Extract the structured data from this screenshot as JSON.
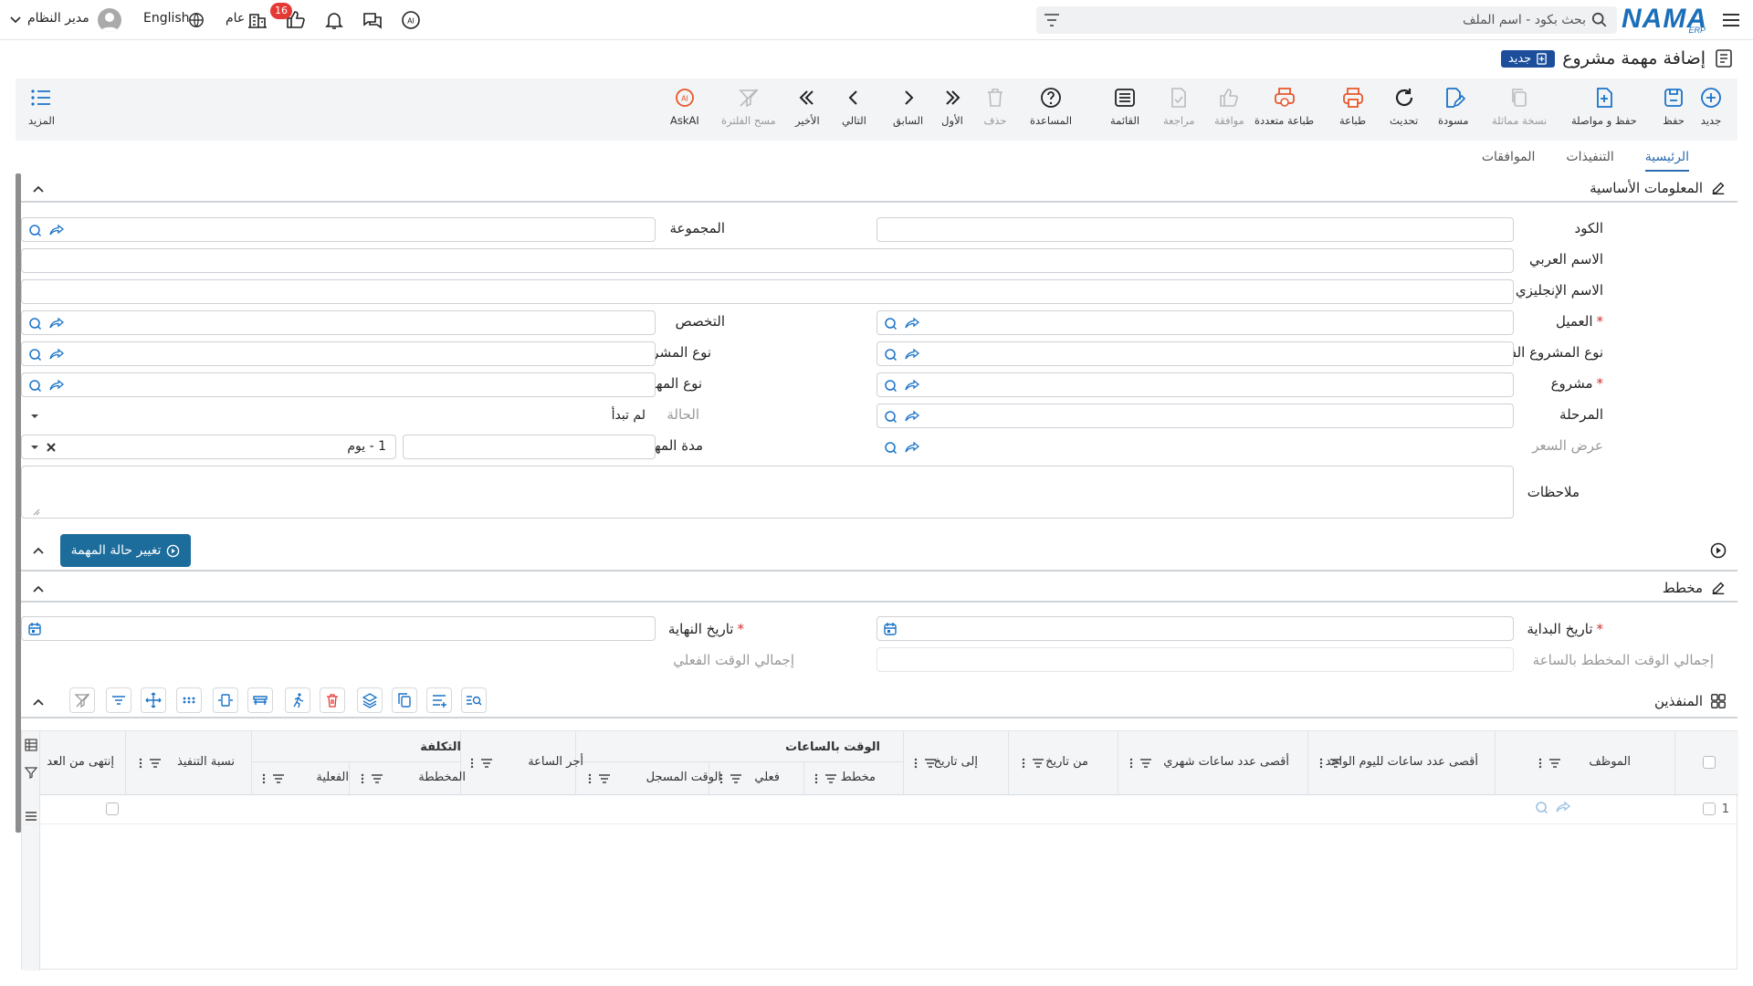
{
  "topbar": {
    "search_placeholder": "بحث بكود - اسم الملف",
    "badge_count": "16",
    "general_label": "عام",
    "language_label": "English",
    "user_name": "مدير النظام",
    "logo_text": "NAMA",
    "logo_sub": "ERP"
  },
  "page": {
    "title": "إضافة مهمة مشروع",
    "new_badge": "جديد"
  },
  "toolbar": {
    "new": "جديد",
    "save": "حفظ",
    "save_continue": "حفظ و مواصلة",
    "duplicate": "نسخة مماثلة",
    "draft": "مسودة",
    "refresh": "تحديث",
    "print": "طباعة",
    "multi_print": "طباعة متعددة",
    "approve": "موافقة",
    "review": "مراجعة",
    "list": "القائمة",
    "help": "المساعدة",
    "delete": "حذف",
    "first": "الأول",
    "previous": "السابق",
    "next": "التالي",
    "last": "الأخير",
    "clear_filter": "مسح الفلترة",
    "askai": "AskAI",
    "more": "المزيد"
  },
  "tabs": [
    "الرئيسية",
    "التنفيذات",
    "الموافقات"
  ],
  "basic_info": {
    "title": "المعلومات الأساسية",
    "code": "الكود",
    "group": "المجموعة",
    "arabic_name": "الاسم العربي",
    "english_name": "الاسم الإنجليزي",
    "customer": "العميل",
    "specialization": "التخصص",
    "sub_project_type": "نوع المشروع الفرعى",
    "project_type": "نوع المشروع",
    "project": "مشروع",
    "task_type": "نوع المهمة",
    "stage": "المرحلة",
    "status": "الحالة",
    "status_value": "لم تبدأ",
    "price_offer": "عرض السعر",
    "task_duration": "مدة المهمة",
    "duration_value": "1 - يوم",
    "notes": "ملاحظات"
  },
  "action": {
    "change_status": "تغيير حالة المهمة"
  },
  "plan": {
    "title": "مخطط",
    "start_date": "تاريخ البداية",
    "end_date": "تاريخ النهاية",
    "planned_total": "إجمالي الوقت المخطط بالساعة",
    "actual_total": "إجمالي الوقت الفعلي"
  },
  "executors": {
    "title": "المنفذين",
    "columns": {
      "employee": "الموظف",
      "max_daily": "أقصى عدد ساعات لليوم الواحد",
      "max_monthly": "أقصى عدد ساعات شهري",
      "from_date": "من تاريخ",
      "to_date": "إلى تاريخ",
      "time_hours": "الوقت بالساعات",
      "planned": "مخطط",
      "actual": "فعلي",
      "logged": "الوقت المسجل",
      "hour_rate": "أجر الساعة",
      "cost": "التكلفة",
      "cost_planned": "المخططة",
      "cost_actual": "الفعلية",
      "exec_ratio": "نسبة التنفيذ",
      "finished_from": "إنتهى من العد"
    },
    "rows": [
      {
        "index": "1"
      }
    ]
  },
  "colors": {
    "primary": "#1a73c8",
    "brand": "#1a6fb8",
    "badge_red": "#e53935",
    "status_button": "#1c6c9c",
    "print_orange": "#e8562a"
  }
}
